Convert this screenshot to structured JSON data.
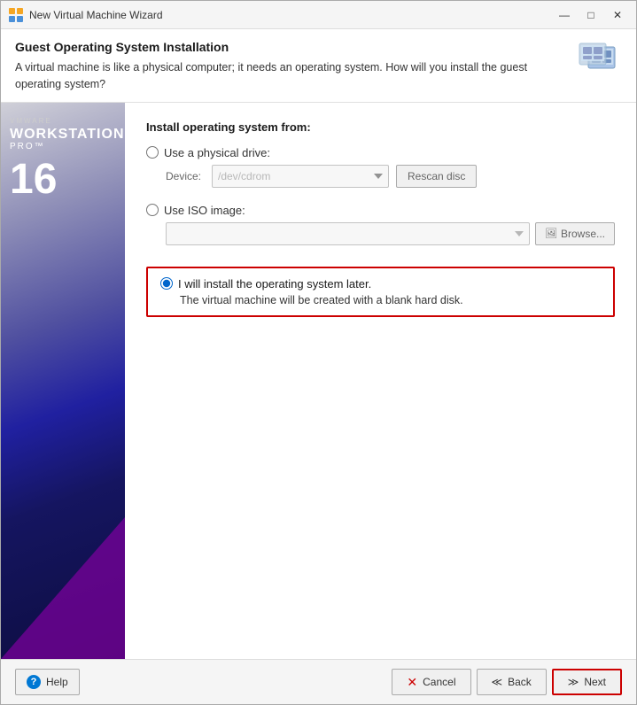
{
  "window": {
    "title": "New Virtual Machine Wizard",
    "controls": {
      "minimize": "—",
      "maximize": "□",
      "close": "✕"
    }
  },
  "header": {
    "title": "Guest Operating System Installation",
    "description": "A virtual machine is like a physical computer; it needs an operating system. How will you install the guest operating system?"
  },
  "sidebar": {
    "vmware_label": "VMWARE",
    "product_line1": "WORKSTATION",
    "product_pro": "PRO™",
    "version": "16"
  },
  "main": {
    "section_title": "Install operating system from:",
    "option_physical": {
      "label": "Use a physical drive:",
      "device_label": "Device:",
      "device_value": "/dev/cdrom",
      "rescan_label": "Rescan disc"
    },
    "option_iso": {
      "label": "Use ISO image:",
      "browse_label": "Browse..."
    },
    "option_later": {
      "label": "I will install the operating system later.",
      "description": "The virtual machine will be created with a blank hard disk."
    }
  },
  "footer": {
    "help_label": "Help",
    "cancel_label": "Cancel",
    "back_label": "< Back",
    "next_label": "Next"
  }
}
